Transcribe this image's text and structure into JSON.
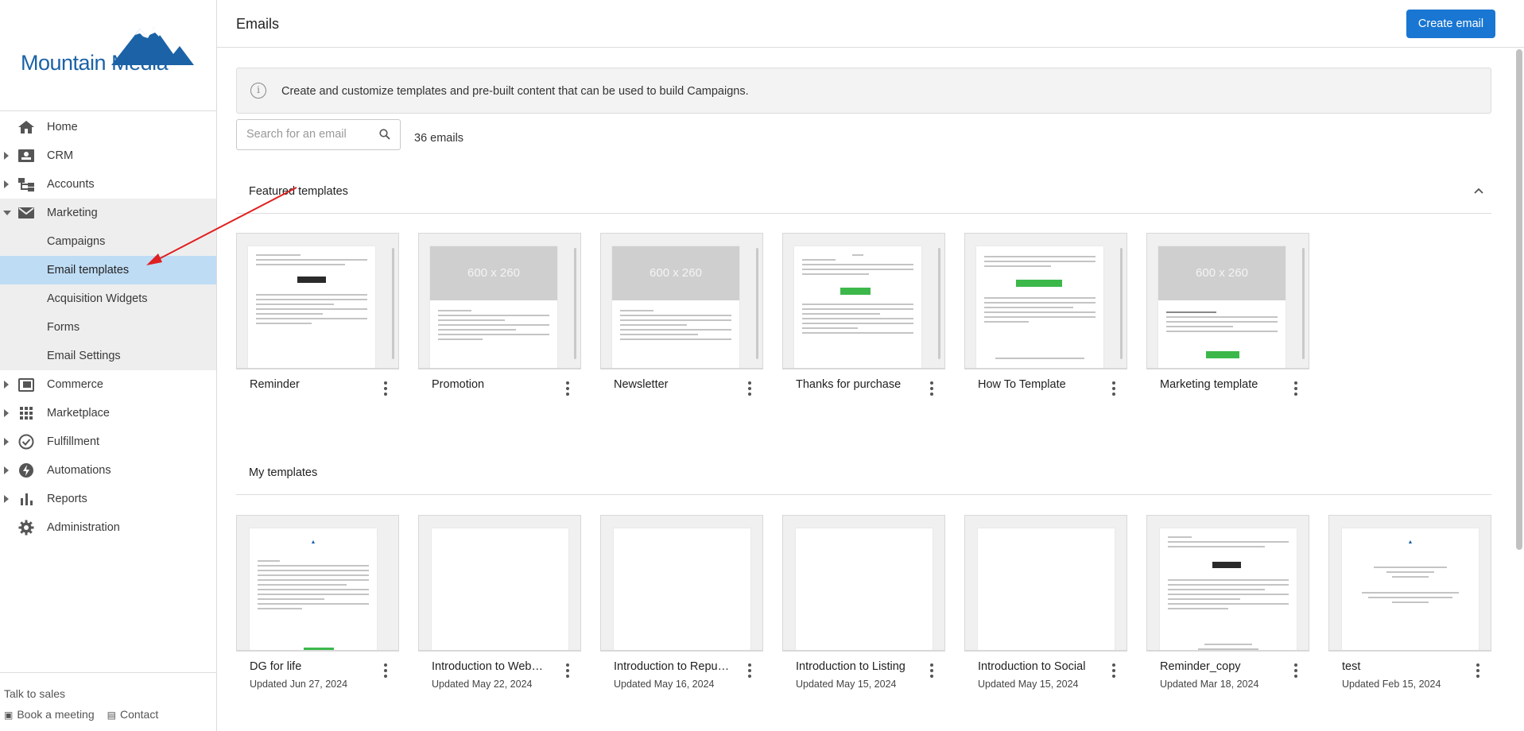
{
  "brand": {
    "name": "Mountain Media"
  },
  "sidebar": {
    "items": [
      {
        "label": "Home",
        "icon": "home-icon"
      },
      {
        "label": "CRM",
        "icon": "contact-card-icon"
      },
      {
        "label": "Accounts",
        "icon": "org-chart-icon"
      },
      {
        "label": "Marketing",
        "icon": "mail-icon"
      }
    ],
    "marketing_sub": [
      "Campaigns",
      "Email templates",
      "Acquisition Widgets",
      "Forms",
      "Email Settings"
    ],
    "active_sub": "Email templates",
    "more_items": [
      {
        "label": "Commerce",
        "icon": "store-icon"
      },
      {
        "label": "Marketplace",
        "icon": "grid-icon"
      },
      {
        "label": "Fulfillment",
        "icon": "check-circle-icon"
      },
      {
        "label": "Automations",
        "icon": "bolt-icon"
      },
      {
        "label": "Reports",
        "icon": "bar-chart-icon"
      },
      {
        "label": "Administration",
        "icon": "gear-icon"
      }
    ],
    "footer": {
      "talk": "Talk to sales",
      "meeting": "Book a meeting",
      "contact": "Contact"
    }
  },
  "header": {
    "title": "Emails",
    "create_label": "Create email"
  },
  "info": {
    "text": "Create and customize templates and pre-built content that can be used to build Campaigns."
  },
  "search": {
    "placeholder": "Search for an email",
    "count": "36 emails"
  },
  "featured": {
    "title": "Featured templates",
    "cards": [
      {
        "name": "Reminder"
      },
      {
        "name": "Promotion",
        "placeholder": "600 x 260"
      },
      {
        "name": "Newsletter",
        "placeholder": "600 x 260"
      },
      {
        "name": "Thanks for purchase"
      },
      {
        "name": "How To Template"
      },
      {
        "name": "Marketing template",
        "placeholder": "600 x 260"
      }
    ]
  },
  "mine": {
    "title": "My templates",
    "cards": [
      {
        "name": "DG for life",
        "updated": "Updated Jun 27, 2024"
      },
      {
        "name": "Introduction to Web…",
        "updated": "Updated May 22, 2024"
      },
      {
        "name": "Introduction to Repu…",
        "updated": "Updated May 16, 2024"
      },
      {
        "name": "Introduction to Listing",
        "updated": "Updated May 15, 2024"
      },
      {
        "name": "Introduction to Social",
        "updated": "Updated May 15, 2024"
      },
      {
        "name": "Reminder_copy",
        "updated": "Updated Mar 18, 2024"
      },
      {
        "name": "test",
        "updated": "Updated Feb 15, 2024"
      }
    ]
  },
  "colors": {
    "primary": "#1976d2",
    "active_nav": "#bfdcf5",
    "brand": "#1b62a6",
    "annotation_arrow": "#e02020"
  }
}
